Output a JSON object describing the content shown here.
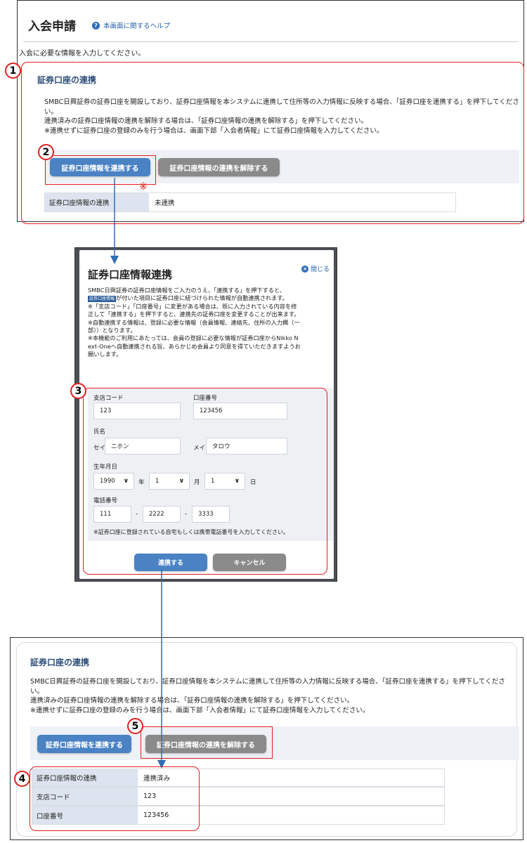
{
  "panel1": {
    "page_title": "入会申請",
    "help_link": "本画面に関するヘルプ",
    "intro": "入会に必要な情報を入力してください。",
    "section_title": "証券口座の連携",
    "description": "SMBC日興証券の証券口座を開設しており、証券口座情報を本システムに連携して住所等の入力情報に反映する場合、「証券口座を連携する」を押下してください。\n連携済みの証券口座情報の連携を解除する場合は、「証券口座情報の連携を解除する」を押下してください。\n※連携せずに証券口座の登録のみを行う場合は、画面下部「入会者情報」にて証券口座情報を入力してください。",
    "link_button": "証券口座情報を連携する",
    "unlink_button": "証券口座情報の連携を解除する",
    "status_label": "証券口座情報の連携",
    "status_value": "未連携"
  },
  "modal": {
    "title": "証券口座情報連携",
    "close": "閉じる",
    "desc_line1": "SMBC日興証券の証券口座情報をご入力のうえ、「連携する」を押下すると、",
    "tag": "証券口座情報",
    "desc_line2": "が付いた項目に証券口座に紐づけられた情報が自動連携されます。",
    "desc_rest": [
      "※「支店コード」「口座番号」に変更がある場合は、既に入力されている内容を修",
      "正して「連携する」を押下すると、連携先の証券口座を変更することが出来ます。",
      "※自動連携する情報は、登録に必要な情報（会員情報、連絡先、住所の入力欄（一",
      "部））となります。",
      "※本機能のご利用にあたっては、会員の登録に必要な情報が証券口座からNikko N",
      "ext-Oneへ自動連携される旨、あらかじめ会員より同意を得ていただきますようお",
      "願いします。"
    ],
    "branch_label": "支店コード",
    "branch_value": "123",
    "account_label": "口座番号",
    "account_value": "123456",
    "name_label": "氏名",
    "sei_label": "セイ",
    "sei_value": "ニホン",
    "mei_label": "メイ",
    "mei_value": "タロウ",
    "dob_label": "生年月日",
    "year_value": "1990",
    "year_unit": "年",
    "month_value": "1",
    "month_unit": "月",
    "day_value": "1",
    "day_unit": "日",
    "phone_label": "電話番号",
    "phone1": "111",
    "phone2": "2222",
    "phone3": "3333",
    "dash": "-",
    "phone_note": "※証券口座に登録されている自宅もしくは携帯電話番号を入力してください。",
    "submit": "連携する",
    "cancel": "キャンセル"
  },
  "panel3": {
    "section_title": "証券口座の連携",
    "description": "SMBC日興証券の証券口座を開設しており、証券口座情報を本システムに連携して住所等の入力情報に反映する場合、「証券口座を連携する」を押下してください。\n連携済みの証券口座情報の連携を解除する場合は、「証券口座情報の連携を解除する」を押下してください。\n※連携せずに証券口座の登録のみを行う場合は、画面下部「入会者情報」にて証券口座情報を入力してください。",
    "link_button": "証券口座情報を連携する",
    "unlink_button": "証券口座情報の連携を解除する",
    "rows": [
      {
        "label": "証券口座情報の連携",
        "value": "連携済み"
      },
      {
        "label": "支店コード",
        "value": "123"
      },
      {
        "label": "口座番号",
        "value": "123456"
      }
    ]
  },
  "annotations": {
    "badge1": "1",
    "badge2": "2",
    "badge3": "3",
    "badge4": "4",
    "badge5": "5",
    "note_mark": "※"
  },
  "colors": {
    "accent_red": "#e02020",
    "button_blue": "#4a82c4",
    "button_gray": "#8a8a8a",
    "label_bg": "#dde4ef",
    "arrow_blue": "#2f6db5"
  }
}
